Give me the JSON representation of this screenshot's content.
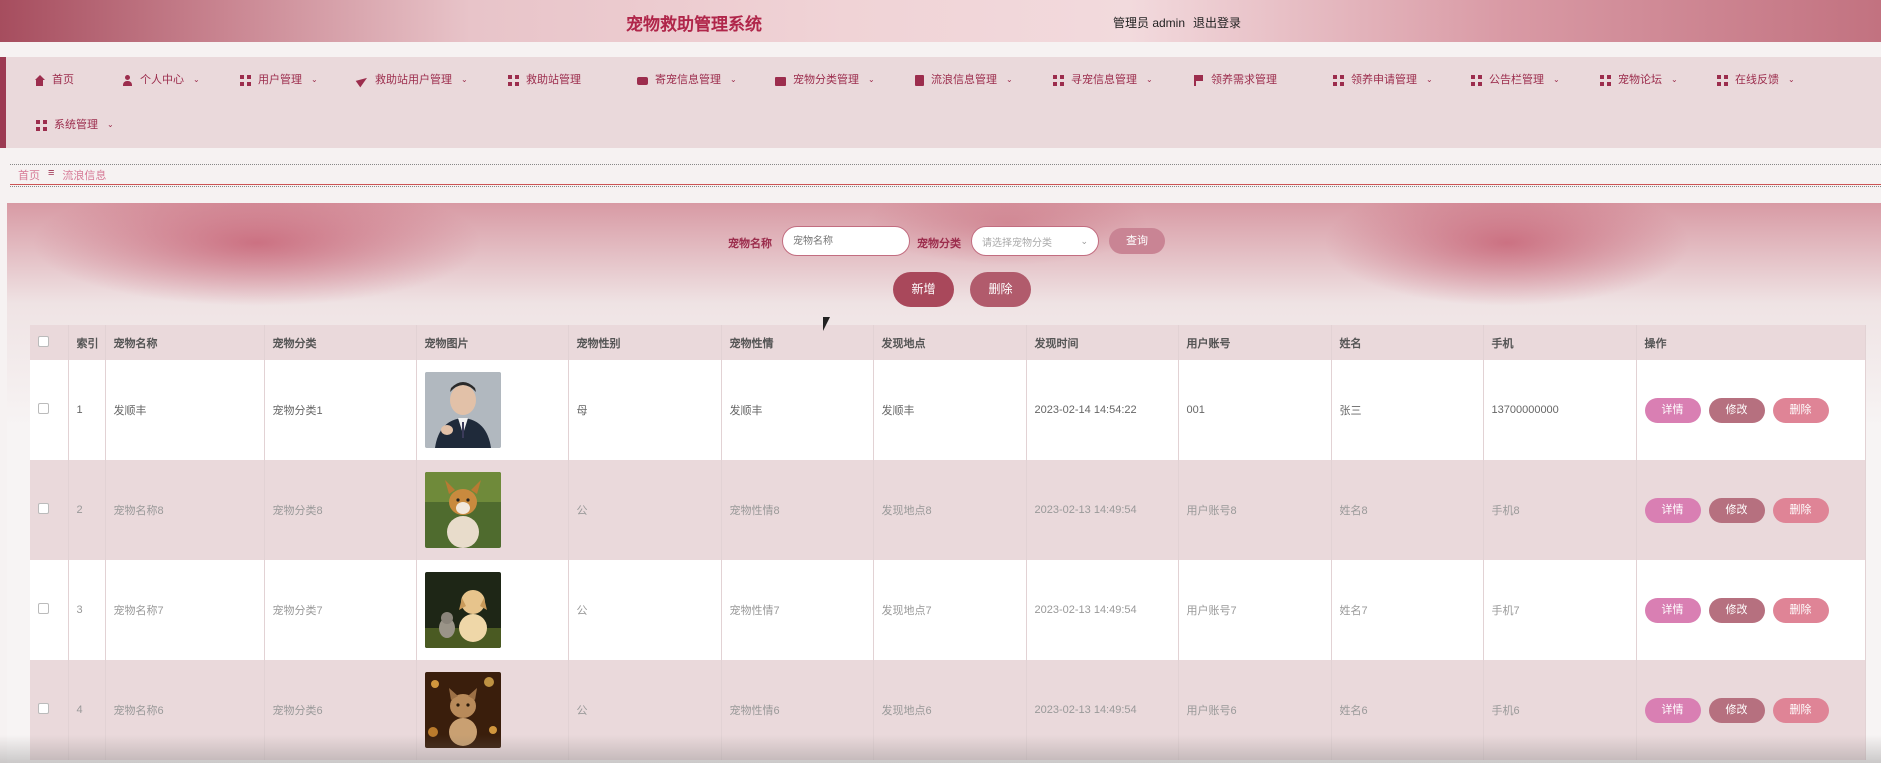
{
  "header": {
    "title": "宠物救助管理系统",
    "admin_label": "管理员 admin",
    "logout": "退出登录"
  },
  "nav": {
    "items": [
      {
        "label": "首页",
        "icon": "home-icon",
        "caret": false
      },
      {
        "label": "个人中心",
        "icon": "user-icon",
        "caret": true
      },
      {
        "label": "用户管理",
        "icon": "grid-icon",
        "caret": true
      },
      {
        "label": "救助站用户管理",
        "icon": "paper-plane-icon",
        "caret": true
      },
      {
        "label": "救助站管理",
        "icon": "grid-icon",
        "caret": false
      },
      {
        "label": "寄宠信息管理",
        "icon": "chat-icon",
        "caret": true
      },
      {
        "label": "宠物分类管理",
        "icon": "briefcase-icon",
        "caret": true
      },
      {
        "label": "流浪信息管理",
        "icon": "document-icon",
        "caret": true
      },
      {
        "label": "寻宠信息管理",
        "icon": "grid-icon",
        "caret": true
      },
      {
        "label": "领养需求管理",
        "icon": "flag-icon",
        "caret": false
      },
      {
        "label": "领养申请管理",
        "icon": "grid-icon",
        "caret": true
      },
      {
        "label": "公告栏管理",
        "icon": "grid-icon",
        "caret": true
      },
      {
        "label": "宠物论坛",
        "icon": "grid-icon",
        "caret": true
      },
      {
        "label": "在线反馈",
        "icon": "grid-icon",
        "caret": true
      },
      {
        "label": "系统管理",
        "icon": "grid-icon",
        "caret": true
      }
    ]
  },
  "breadcrumb": {
    "home": "首页",
    "separator": "≡",
    "current": "流浪信息"
  },
  "search": {
    "name_label": "宠物名称",
    "name_placeholder": "宠物名称",
    "category_label": "宠物分类",
    "category_placeholder": "请选择宠物分类",
    "query_button": "查询"
  },
  "actions": {
    "add": "新增",
    "delete": "删除"
  },
  "table": {
    "headers": [
      "索引",
      "宠物名称",
      "宠物分类",
      "宠物图片",
      "宠物性别",
      "宠物性情",
      "发现地点",
      "发现时间",
      "用户账号",
      "姓名",
      "手机",
      "操作"
    ],
    "rows": [
      {
        "index": "1",
        "name": "发顺丰",
        "category": "宠物分类1",
        "image": "man-in-suit",
        "gender": "母",
        "temper": "发顺丰",
        "location": "发顺丰",
        "time": "2023-02-14 14:54:22",
        "account": "001",
        "person": "张三",
        "phone": "13700000000"
      },
      {
        "index": "2",
        "name": "宠物名称8",
        "category": "宠物分类8",
        "image": "corgi-dog",
        "gender": "公",
        "temper": "宠物性情8",
        "location": "发现地点8",
        "time": "2023-02-13 14:49:54",
        "account": "用户账号8",
        "person": "姓名8",
        "phone": "手机8"
      },
      {
        "index": "3",
        "name": "宠物名称7",
        "category": "宠物分类7",
        "image": "puppy-and-kitten",
        "gender": "公",
        "temper": "宠物性情7",
        "location": "发现地点7",
        "time": "2023-02-13 14:49:54",
        "account": "用户账号7",
        "person": "姓名7",
        "phone": "手机7"
      },
      {
        "index": "4",
        "name": "宠物名称6",
        "category": "宠物分类6",
        "image": "cat-with-lights",
        "gender": "公",
        "temper": "宠物性情6",
        "location": "发现地点6",
        "time": "2023-02-13 14:49:54",
        "account": "用户账号6",
        "person": "姓名6",
        "phone": "手机6"
      }
    ],
    "op_labels": {
      "detail": "详情",
      "edit": "修改",
      "delete": "删除"
    }
  },
  "colors": {
    "accent": "#9c2d4d",
    "nav_bg": "#ead9db",
    "detail_btn": "#d97fb3",
    "edit_btn": "#b6707f",
    "delete_btn": "#df8496"
  }
}
